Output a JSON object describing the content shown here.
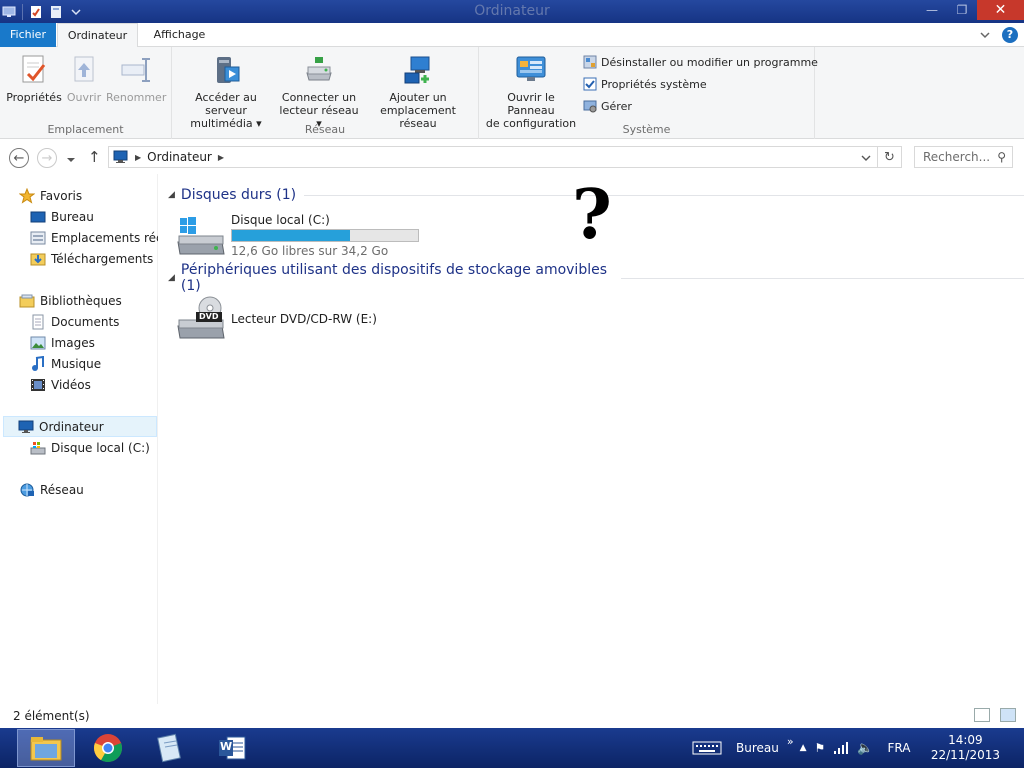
{
  "window": {
    "title": "Ordinateur",
    "minimize": "—",
    "restore": "❐",
    "close": "✕"
  },
  "ribbon_tabs": {
    "file": "Fichier",
    "computer": "Ordinateur",
    "view": "Affichage"
  },
  "ribbon": {
    "location": {
      "label": "Emplacement",
      "properties": "Propriétés",
      "open": "Ouvrir",
      "rename": "Renommer"
    },
    "network": {
      "label": "Réseau",
      "media_server_line1": "Accéder au serveur",
      "media_server_line2": "multimédia",
      "map_drive_line1": "Connecter un",
      "map_drive_line2": "lecteur réseau",
      "add_location_line1": "Ajouter un",
      "add_location_line2": "emplacement réseau"
    },
    "system": {
      "label": "Système",
      "control_panel_line1": "Ouvrir le Panneau",
      "control_panel_line2": "de configuration",
      "uninstall": "Désinstaller ou modifier un programme",
      "system_properties": "Propriétés système",
      "manage": "Gérer"
    }
  },
  "address": {
    "path": "Ordinateur",
    "search_placeholder": "Recherch..."
  },
  "nav_pane": {
    "favorites": "Favoris",
    "desktop": "Bureau",
    "recent": "Emplacements récents",
    "downloads": "Téléchargements",
    "libraries": "Bibliothèques",
    "documents": "Documents",
    "images": "Images",
    "music": "Musique",
    "videos": "Vidéos",
    "computer": "Ordinateur",
    "local_disk": "Disque local (C:)",
    "network": "Réseau"
  },
  "content": {
    "hard_disks_header": "Disques durs (1)",
    "local_disk_name": "Disque local (C:)",
    "local_disk_free": "12,6 Go libres sur 34,2 Go",
    "local_disk_used_fraction": 0.632,
    "removable_header": "Périphériques utilisant des dispositifs de stockage amovibles (1)",
    "dvd_name": "Lecteur DVD/CD-RW (E:)",
    "dvd_badge": "DVD",
    "question_mark": "?"
  },
  "status": {
    "count": "2 élément(s)"
  },
  "taskbar": {
    "desktop_label": "Bureau",
    "language": "FRA",
    "time": "14:09",
    "date": "22/11/2013",
    "word_letter": "W"
  },
  "colors": {
    "accent": "#1979ca",
    "header_text": "#1e3287",
    "bar_fill": "#26a0da",
    "taskbar": "#0f2b78"
  }
}
